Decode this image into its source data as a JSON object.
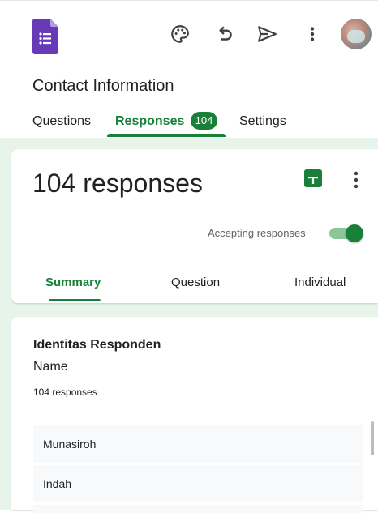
{
  "app": {
    "title": "Contact Information"
  },
  "toolbar": {
    "icons": [
      "palette-icon",
      "undo-icon",
      "send-icon",
      "more-vert-icon",
      "avatar"
    ]
  },
  "tabs": [
    {
      "label": "Questions"
    },
    {
      "label": "Responses",
      "badge": "104"
    },
    {
      "label": "Settings"
    }
  ],
  "responses": {
    "count_label": "104 responses",
    "accepting_label": "Accepting responses",
    "accepting": true,
    "subtabs": [
      "Summary",
      "Question",
      "Individual"
    ]
  },
  "question": {
    "section": "Identitas Responden",
    "title": "Name",
    "count": "104 responses",
    "answers": [
      "Munasiroh",
      "Indah"
    ]
  },
  "colors": {
    "accent": "#188038",
    "forms_purple": "#673ab7",
    "page_bg": "#e6f4ea"
  }
}
